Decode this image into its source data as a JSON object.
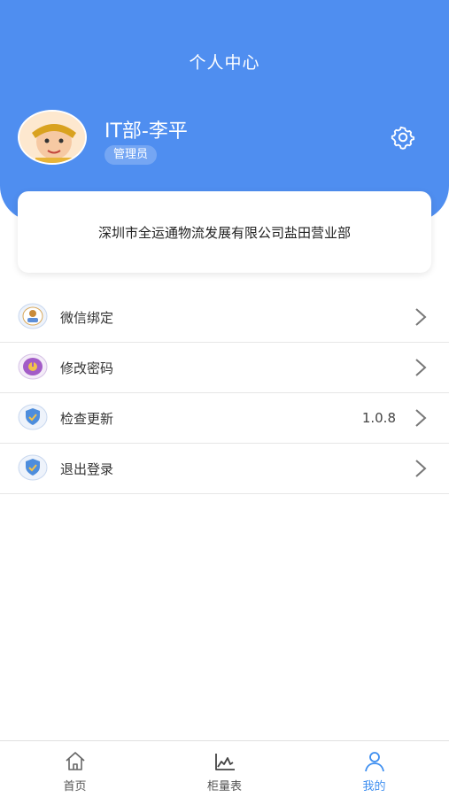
{
  "header": {
    "title": "个人中心"
  },
  "profile": {
    "name": "IT部-李平",
    "role": "管理员",
    "company": "深圳市全运通物流发展有限公司盐田营业部"
  },
  "menu": {
    "items": [
      {
        "label": "微信绑定",
        "icon": "wechat-bind-icon",
        "value": ""
      },
      {
        "label": "修改密码",
        "icon": "password-icon",
        "value": ""
      },
      {
        "label": "检查更新",
        "icon": "shield-check-icon",
        "value": "1.0.8"
      },
      {
        "label": "退出登录",
        "icon": "shield-logout-icon",
        "value": ""
      }
    ]
  },
  "tabbar": {
    "tabs": [
      {
        "label": "首页",
        "icon": "home-icon",
        "active": false
      },
      {
        "label": "柜量表",
        "icon": "chart-line-icon",
        "active": false
      },
      {
        "label": "我的",
        "icon": "user-icon",
        "active": true
      }
    ]
  },
  "colors": {
    "primary": "#4f8ef0",
    "active_tab": "#3d8ef0"
  }
}
